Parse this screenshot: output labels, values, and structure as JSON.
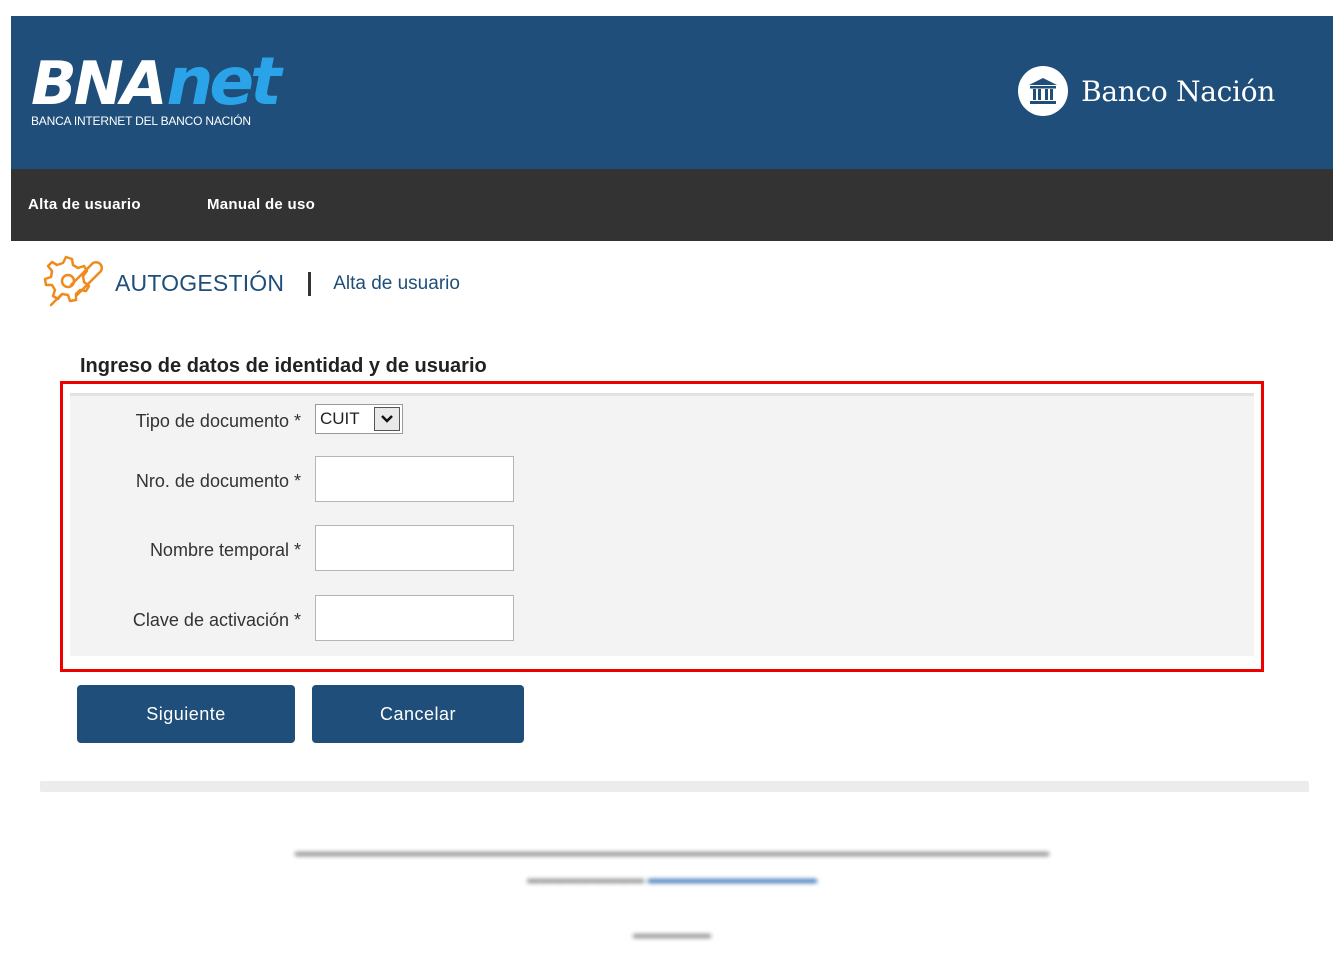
{
  "header": {
    "logo_primary": "BNA",
    "logo_secondary": "net",
    "logo_subtitle": "BANCA INTERNET DEL BANCO NACIÓN",
    "bank_name": "Banco Nación"
  },
  "nav": {
    "items": [
      {
        "label": "Alta de usuario"
      },
      {
        "label": "Manual de uso"
      }
    ]
  },
  "section": {
    "title": "AUTOGESTIÓN",
    "subtitle": "Alta de usuario"
  },
  "form": {
    "title": "Ingreso de datos de identidad y de usuario",
    "fields": [
      {
        "label": "Tipo de documento *",
        "type": "select",
        "value": "CUIT"
      },
      {
        "label": "Nro. de documento *",
        "type": "text",
        "value": ""
      },
      {
        "label": "Nombre temporal *",
        "type": "text",
        "value": ""
      },
      {
        "label": "Clave de activación *",
        "type": "text",
        "value": ""
      }
    ]
  },
  "buttons": {
    "next": "Siguiente",
    "cancel": "Cancelar"
  },
  "colors": {
    "brand_blue": "#1e4e79",
    "nav_dark": "#333333",
    "highlight_red": "#ee0000",
    "accent_orange": "#f08a1c"
  }
}
